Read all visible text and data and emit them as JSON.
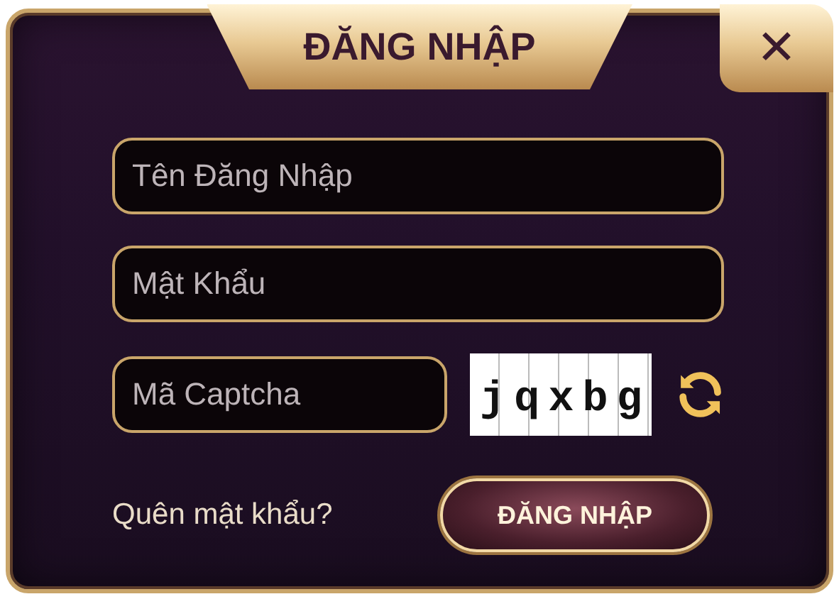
{
  "dialog": {
    "title": "ĐĂNG NHẬP",
    "close": "✕"
  },
  "fields": [
    {
      "placeholder": "Tên Đăng Nhập"
    },
    {
      "placeholder": "Mật Khẩu"
    }
  ],
  "captcha": {
    "placeholder": "Mã Captcha",
    "code": "jqxbg"
  },
  "forgot": "Quên mật khẩu?",
  "submit": "ĐĂNG NHẬP"
}
